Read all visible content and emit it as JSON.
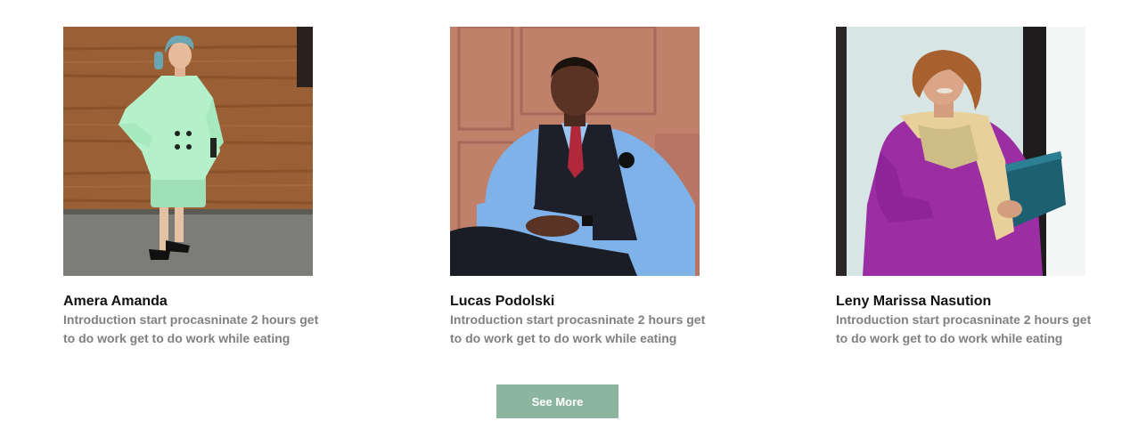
{
  "team": [
    {
      "name": "Amera Amanda",
      "intro": "Introduction start procasninate 2 hours get to do work get to do work while eating",
      "photo_alt": "Woman in mint green suit"
    },
    {
      "name": "Lucas Podolski",
      "intro": "Introduction start procasninate 2 hours get to do work get to do work while eating",
      "photo_alt": "Man in blue shirt and vest"
    },
    {
      "name": "Leny Marissa Nasution",
      "intro": "Introduction start procasninate 2 hours get to do work get to do work while eating",
      "photo_alt": "Woman in purple dress holding folder"
    }
  ],
  "see_more_label": "See More",
  "colors": {
    "button_bg": "#8cb5a0",
    "intro_text": "#808080",
    "name_text": "#111111"
  }
}
